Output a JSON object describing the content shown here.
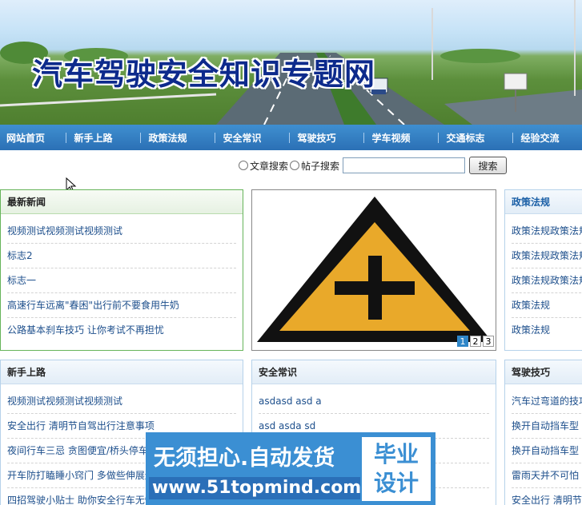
{
  "site_title": "汽车驾驶安全知识专题网",
  "nav": [
    "网站首页",
    "新手上路",
    "政策法规",
    "安全常识",
    "驾驶技巧",
    "学车视频",
    "交通标志",
    "经验交流"
  ],
  "search": {
    "option_article": "文章搜索",
    "option_post": "帖子搜索",
    "input_value": "",
    "button": "搜索"
  },
  "latest_news": {
    "title": "最新新闻",
    "items": [
      "视频测试视频测试视频测试",
      "标志2",
      "标志一",
      "高速行车远离\"春困\"出行前不要食用牛奶",
      "公路基本刹车技巧 让你考试不再担忧"
    ]
  },
  "slideshow": {
    "pages": [
      "1",
      "2",
      "3"
    ],
    "active_page": 1
  },
  "policy": {
    "title": "政策法规",
    "items": [
      "政策法规政策法规",
      "政策法规政策法规",
      "政策法规政策法规",
      "政策法规",
      "政策法规"
    ]
  },
  "newbie": {
    "title": "新手上路",
    "items": [
      "视频测试视频测试视频测试",
      "安全出行 清明节自驾出行注意事项",
      "夜间行车三忌 贪图便宜/桥头停车",
      "开车防打瞌睡小窍门 多做些伸展运动",
      "四招驾驶小贴士 助你安全行车无忧"
    ]
  },
  "safety": {
    "title": "安全常识",
    "items": [
      "asdasd asd a",
      "asd asda sd",
      "",
      "",
      ""
    ]
  },
  "skills": {
    "title": "驾驶技巧",
    "items": [
      "汽车过弯道的技巧",
      "换开自动挡车型",
      "换开自动挡车型",
      "雷雨天并不可怕",
      "安全出行 清明节"
    ]
  },
  "ad": {
    "line1": "无须担心.自动发货",
    "url": "www.51topmind.com",
    "badge_line1": "毕业",
    "badge_line2": "设计"
  },
  "colors": {
    "nav_bg": "#2f7fc4",
    "title_blue": "#0d2a8c",
    "link": "#1d4f8c",
    "sign_yellow": "#e9a92a"
  }
}
